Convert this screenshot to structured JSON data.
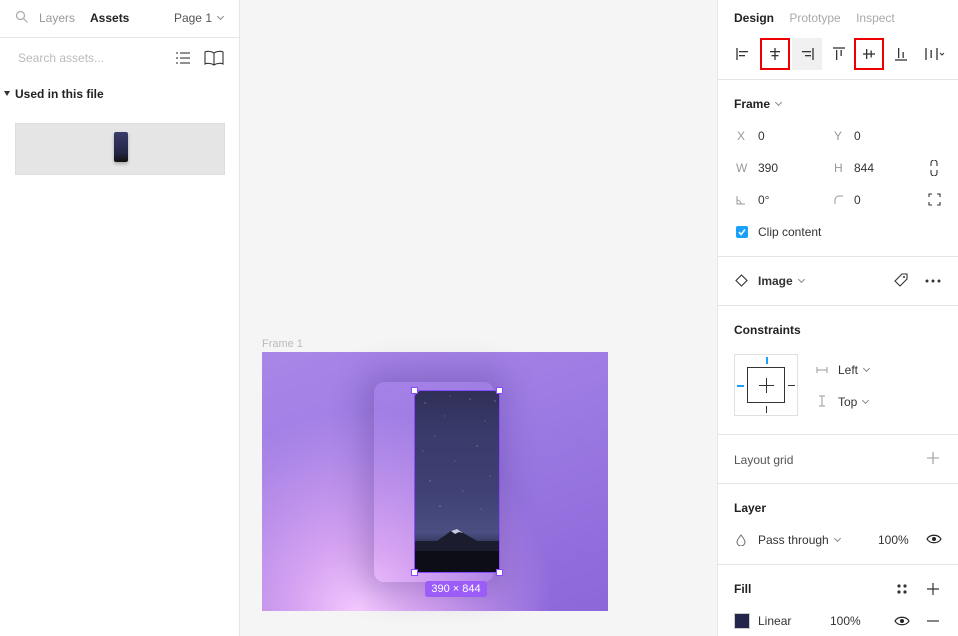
{
  "left_panel": {
    "tabs": {
      "layers": "Layers",
      "assets": "Assets"
    },
    "page_selector": "Page 1",
    "search_placeholder": "Search assets...",
    "section_title": "Used in this file"
  },
  "canvas": {
    "frame_label": "Frame 1",
    "dimension_badge": "390 × 844"
  },
  "right_panel": {
    "tabs": {
      "design": "Design",
      "prototype": "Prototype",
      "inspect": "Inspect"
    },
    "align_tools": [
      "align-left",
      "align-horizontal-center",
      "align-right",
      "align-top",
      "align-vertical-center",
      "align-bottom",
      "distribute"
    ],
    "frame": {
      "title": "Frame",
      "x_label": "X",
      "x": "0",
      "y_label": "Y",
      "y": "0",
      "w_label": "W",
      "w": "390",
      "h_label": "H",
      "h": "844",
      "rotation": "0°",
      "radius": "0",
      "clip_content": "Clip content"
    },
    "component": {
      "name": "Image"
    },
    "constraints": {
      "title": "Constraints",
      "horizontal": "Left",
      "vertical": "Top"
    },
    "layout_grid": {
      "title": "Layout grid"
    },
    "layer": {
      "title": "Layer",
      "blend": "Pass through",
      "opacity": "100%"
    },
    "fill": {
      "title": "Fill",
      "type": "Linear",
      "opacity": "100%",
      "swatch_color": "#23264a"
    }
  },
  "colors": {
    "accent": "#18a0fb",
    "selection": "#8a4bff",
    "highlight": "#e00000"
  }
}
